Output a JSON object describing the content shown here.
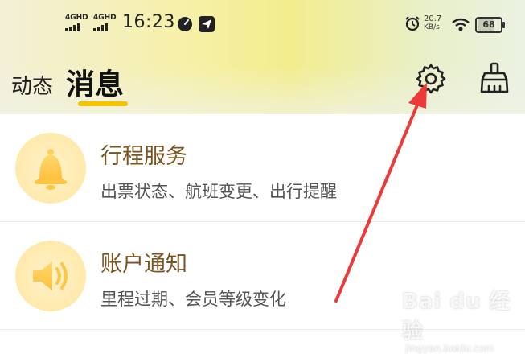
{
  "status_bar": {
    "network_1": "4GHD",
    "network_2": "4GHD",
    "time": "16:23",
    "speed_value": "20.7",
    "speed_unit": "KB/s",
    "battery": "68"
  },
  "header": {
    "tab_dynamic": "动态",
    "tab_messages": "消息",
    "accent_color": "#f5c400"
  },
  "icons": {
    "settings": "gear-icon",
    "clear": "broom-icon"
  },
  "messages": [
    {
      "title": "行程服务",
      "subtitle": "出票状态、航班变更、出行提醒",
      "icon": "bell-icon"
    },
    {
      "title": "账户通知",
      "subtitle": "里程过期、会员等级变化",
      "icon": "speaker-icon"
    }
  ],
  "watermark": {
    "brand": "Bai du 经验",
    "url": "jingyan.baidu.com"
  }
}
